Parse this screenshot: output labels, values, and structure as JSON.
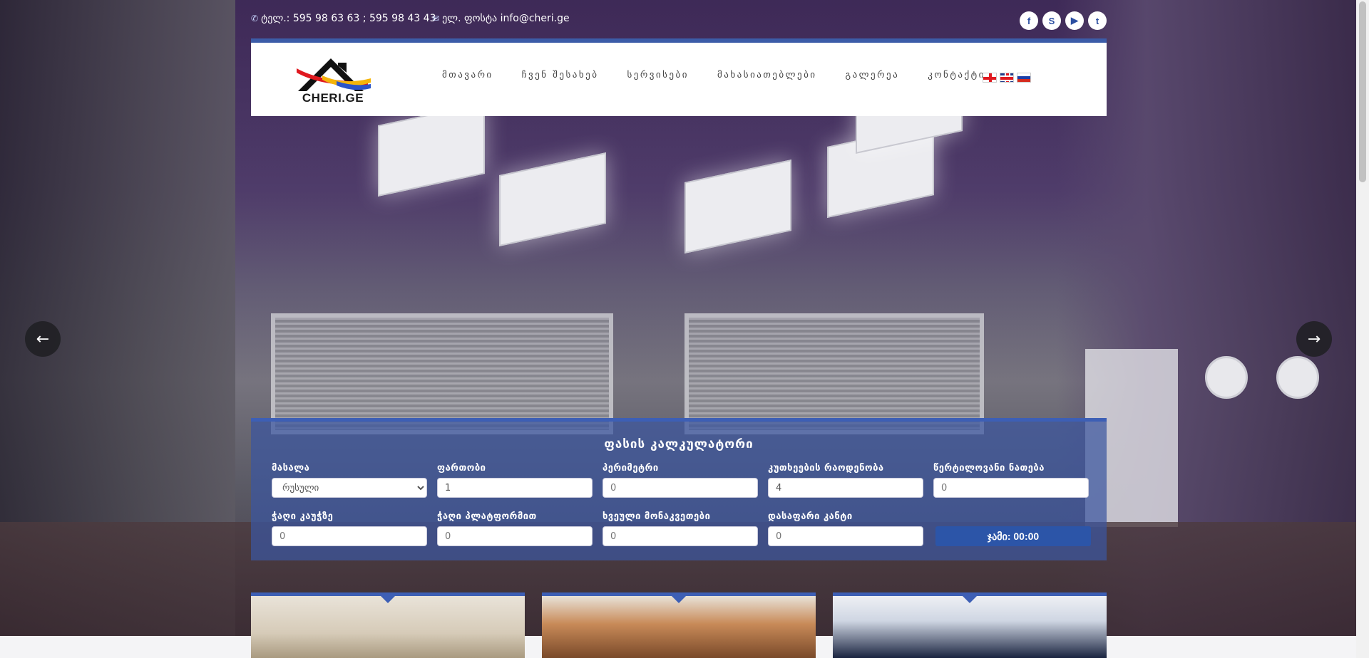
{
  "topbar": {
    "phone": "ტელ.: 595 98 63 63 ; 595 98 43 43",
    "email": "ელ. ფოსტა info@cheri.ge",
    "social": [
      {
        "icon": "facebook-icon",
        "glyph": "f"
      },
      {
        "icon": "skype-icon",
        "glyph": "S"
      },
      {
        "icon": "youtube-icon",
        "glyph": "▶"
      },
      {
        "icon": "twitter-icon",
        "glyph": "t"
      }
    ]
  },
  "header": {
    "logo_text": "CHERI.GE",
    "nav": [
      "მთავარი",
      "ჩვენ შესახებ",
      "სერვისები",
      "მახასიათებლები",
      "გალერეა",
      "კონტაქტი"
    ],
    "languages": [
      "ge",
      "en",
      "ru"
    ]
  },
  "slider": {
    "prev_glyph": "←",
    "next_glyph": "→"
  },
  "calculator": {
    "title": "ფასის კალკულატორი",
    "fields": {
      "material": {
        "label": "მასალა",
        "value": "რუსული"
      },
      "area": {
        "label": "ფართობი",
        "value": "1"
      },
      "perimeter": {
        "label": "პერიმეტრი",
        "value": "0"
      },
      "corners": {
        "label": "კუთხეების რაოდენობა",
        "value": "4"
      },
      "spot_lights": {
        "label": "წერტილოვანი ნათება",
        "value": "0"
      },
      "chandelier_hook": {
        "label": "ჭაღი კაუჭზე",
        "value": "0"
      },
      "chandelier_platform": {
        "label": "ჭაღი პლატფორმით",
        "value": "0"
      },
      "pipe_cutouts": {
        "label": "ხვეული მონაკვეთები",
        "value": "0"
      },
      "hidden_edge": {
        "label": "დასაფარი კანტი",
        "value": "0"
      }
    },
    "total": "ჯამი: 00:00"
  },
  "colors": {
    "accent": "#3c5ca8",
    "calc_bg": "#3c56a0",
    "button": "#2c55a8"
  }
}
